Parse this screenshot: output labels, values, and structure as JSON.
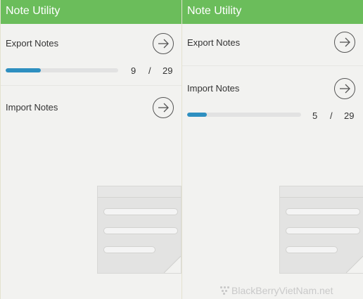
{
  "left_panel": {
    "title": "Note Utility",
    "export": {
      "label": "Export Notes"
    },
    "export_progress": {
      "current": "9",
      "separator": "/",
      "total": "29",
      "fraction": 0.31
    },
    "import": {
      "label": "Import Notes"
    }
  },
  "right_panel": {
    "title": "Note Utility",
    "export": {
      "label": "Export Notes"
    },
    "import": {
      "label": "Import Notes"
    },
    "import_progress": {
      "current": "5",
      "separator": "/",
      "total": "29",
      "fraction": 0.17
    }
  },
  "icons": {
    "arrow_button": "arrow-right-circle-icon",
    "note": "note-document-icon",
    "logo": "blackberry-logo"
  },
  "colors": {
    "title_bar": "#6bbd5b",
    "progress_fill": "#2e8fc0",
    "progress_track": "#e2e2e2"
  },
  "watermark": "BlackBerryVietNam.net"
}
